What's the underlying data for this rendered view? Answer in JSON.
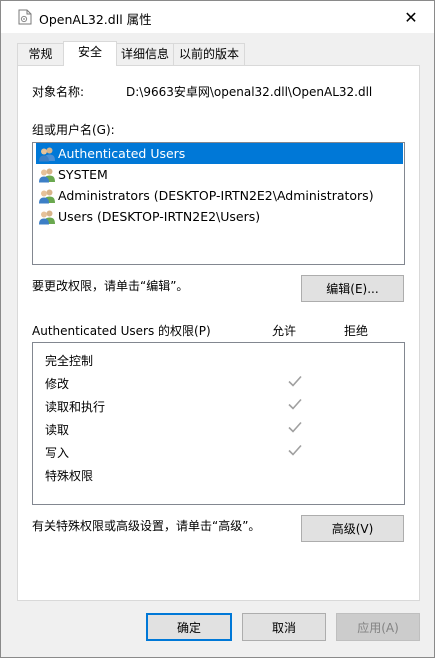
{
  "window": {
    "title": "OpenAL32.dll 属性",
    "close_glyph": "✕"
  },
  "tabs": [
    {
      "label": "常规",
      "active": false
    },
    {
      "label": "安全",
      "active": true
    },
    {
      "label": "详细信息",
      "active": false
    },
    {
      "label": "以前的版本",
      "active": false
    }
  ],
  "object": {
    "label": "对象名称:",
    "value": "D:\\9663安卓网\\openal32.dll\\OpenAL32.dll"
  },
  "groups": {
    "label": "组或用户名(G):",
    "items": [
      {
        "name": "Authenticated Users",
        "selected": true,
        "icon": "group-users-icon"
      },
      {
        "name": "SYSTEM",
        "selected": false,
        "icon": "group-users-icon"
      },
      {
        "name": "Administrators (DESKTOP-IRTN2E2\\Administrators)",
        "selected": false,
        "icon": "group-users-icon"
      },
      {
        "name": "Users (DESKTOP-IRTN2E2\\Users)",
        "selected": false,
        "icon": "group-users-icon"
      }
    ]
  },
  "change_permissions": {
    "text": "要更改权限，请单击“编辑”。",
    "edit_button": "编辑(E)..."
  },
  "permissions": {
    "title": "Authenticated Users 的权限(P)",
    "allow_header": "允许",
    "deny_header": "拒绝",
    "rows": [
      {
        "name": "完全控制",
        "allow": false,
        "deny": false
      },
      {
        "name": "修改",
        "allow": true,
        "deny": false
      },
      {
        "name": "读取和执行",
        "allow": true,
        "deny": false
      },
      {
        "name": "读取",
        "allow": true,
        "deny": false
      },
      {
        "name": "写入",
        "allow": true,
        "deny": false
      },
      {
        "name": "特殊权限",
        "allow": false,
        "deny": false
      }
    ]
  },
  "advanced": {
    "text": "有关特殊权限或高级设置，请单击“高级”。",
    "button": "高级(V)"
  },
  "footer": {
    "ok": "确定",
    "cancel": "取消",
    "apply": "应用(A)"
  },
  "colors": {
    "selection": "#0078d7",
    "check_gray": "#a0a0a0"
  }
}
